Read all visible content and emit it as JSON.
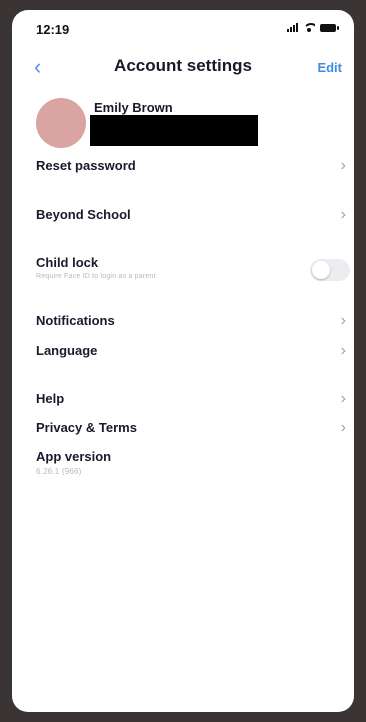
{
  "status_bar": {
    "time": "12:19"
  },
  "header": {
    "back_icon": "‹",
    "title": "Account settings",
    "edit_label": "Edit"
  },
  "profile": {
    "name": "Emily Brown"
  },
  "settings": {
    "reset_password": "Reset password",
    "beyond_school": "Beyond School",
    "child_lock": {
      "label": "Child lock",
      "subtitle": "Require Face ID to login as a parent",
      "enabled": false
    },
    "notifications": "Notifications",
    "language": "Language",
    "help": "Help",
    "privacy_terms": "Privacy & Terms",
    "app_version": {
      "label": "App version",
      "value": "6.26.1 (966)"
    }
  },
  "chevron_icon": "›",
  "colors": {
    "accent": "#3f8de0",
    "avatar": "#d9a4a2",
    "text": "#1a1a2e",
    "muted": "#b7b7c4"
  }
}
